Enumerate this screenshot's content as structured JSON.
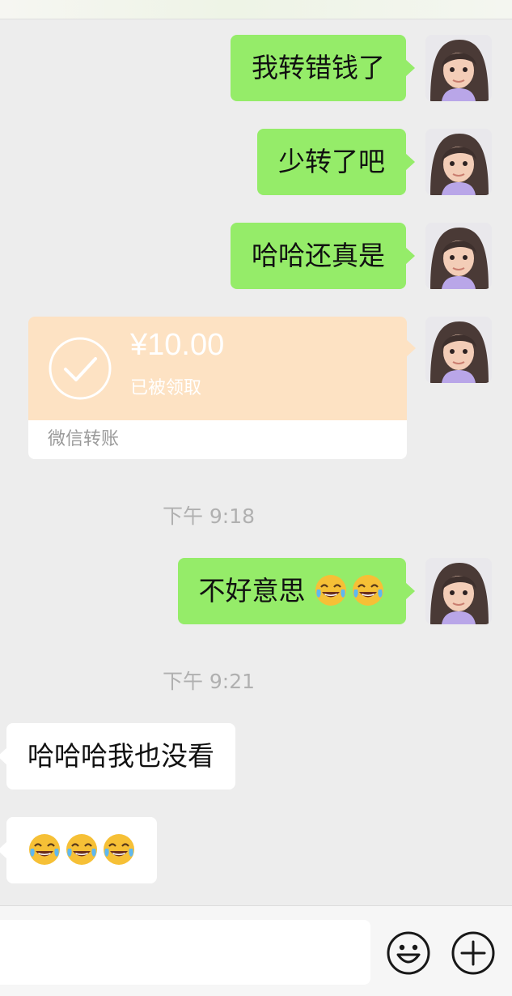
{
  "messages": [
    {
      "text": "我转错钱了"
    },
    {
      "text": "少转了吧"
    },
    {
      "text": "哈哈还真是"
    },
    {
      "text": "不好意思"
    },
    {
      "text": "哈哈哈我也没看"
    }
  ],
  "transfer": {
    "amount": "¥10.00",
    "status": "已被领取",
    "label": "微信转账",
    "color": "#fde2c3"
  },
  "timestamps": [
    "下午 9:18",
    "下午 9:21"
  ],
  "emoji": {
    "name": "face-with-tears-of-joy-icon"
  },
  "colors": {
    "outgoing_bubble": "#95ec69",
    "incoming_bubble": "#ffffff",
    "background": "#ededed"
  },
  "toolbar": {
    "emoji_button": "smiley-face-icon",
    "more_button": "plus-circle-icon"
  }
}
